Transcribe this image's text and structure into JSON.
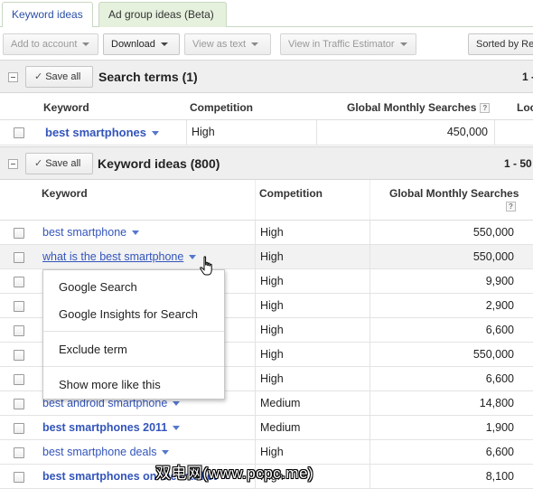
{
  "tabs": [
    {
      "label": "Keyword ideas"
    },
    {
      "label": "Ad group ideas (Beta)"
    }
  ],
  "toolbar": {
    "add_to_account": "Add to account",
    "download": "Download",
    "view_as_text": "View as text",
    "view_in_traffic_estimator": "View in Traffic Estimator",
    "sorted_by": "Sorted by Re"
  },
  "search_terms": {
    "save_all": "Save all",
    "title": "Search terms (1)",
    "count": "1 -",
    "columns": {
      "keyword": "Keyword",
      "competition": "Competition",
      "gms": "Global Monthly Searches",
      "local": "Loc"
    },
    "rows": [
      {
        "keyword": "best smartphones",
        "competition": "High",
        "gms": "450,000"
      }
    ]
  },
  "keyword_ideas": {
    "save_all": "Save all",
    "title": "Keyword ideas (800)",
    "count": "1 - 50",
    "columns": {
      "keyword": "Keyword",
      "competition": "Competition",
      "gms": "Global Monthly Searches"
    },
    "rows": [
      {
        "keyword": "best smartphone",
        "competition": "High",
        "gms": "550,000"
      },
      {
        "keyword": "what is the best smartphone",
        "competition": "High",
        "gms": "550,000"
      },
      {
        "keyword": "",
        "competition": "High",
        "gms": "9,900"
      },
      {
        "keyword": "",
        "competition": "High",
        "gms": "2,900"
      },
      {
        "keyword": "",
        "competition": "High",
        "gms": "6,600"
      },
      {
        "keyword": "",
        "competition": "High",
        "gms": "550,000"
      },
      {
        "keyword": "",
        "competition": "High",
        "gms": "6,600"
      },
      {
        "keyword": "best android smartphone",
        "competition": "Medium",
        "gms": "14,800"
      },
      {
        "keyword": "best smartphones 2011",
        "competition": "Medium",
        "gms": "1,900"
      },
      {
        "keyword": "best smartphone deals",
        "competition": "High",
        "gms": "6,600"
      },
      {
        "keyword": "best smartphones on the market",
        "competition": "High",
        "gms": "8,100"
      }
    ]
  },
  "popup_menu": {
    "items": [
      "Google Search",
      "Google Insights for Search",
      "Exclude term",
      "Show more like this"
    ]
  },
  "watermark": "双电网(www.pcpc.me)"
}
